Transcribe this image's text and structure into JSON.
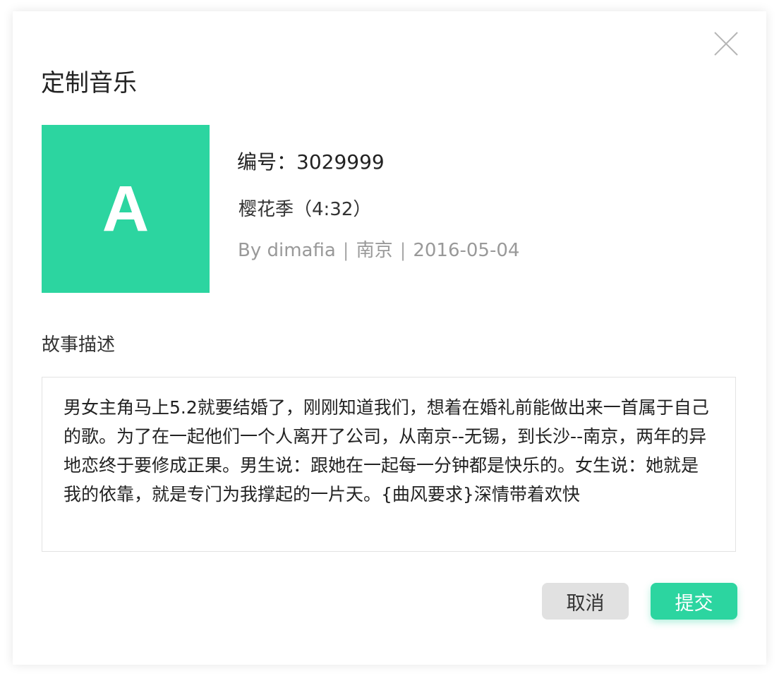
{
  "dialog": {
    "title": "定制音乐",
    "close_icon": "close-icon"
  },
  "music": {
    "cover_letter": "A",
    "cover_color": "#2cd5a0",
    "code_label": "编号：",
    "code_value": "3029999",
    "song": "樱花季（4:32）",
    "author": "By dimafia",
    "separator": "|",
    "city": "南京",
    "date": "2016-05-04"
  },
  "story": {
    "label": "故事描述",
    "text": "男女主角马上5.2就要结婚了，刚刚知道我们，想着在婚礼前能做出来一首属于自己的歌。为了在一起他们一个人离开了公司，从南京--无锡，到长沙--南京，两年的异地恋终于要修成正果。男生说：跟她在一起每一分钟都是快乐的。女生说：她就是我的依靠，就是专门为我撑起的一片天。{曲风要求}深情带着欢快"
  },
  "buttons": {
    "cancel": "取消",
    "submit": "提交"
  },
  "colors": {
    "accent": "#2cd5a0",
    "cancel_bg": "#e1e1e1"
  }
}
